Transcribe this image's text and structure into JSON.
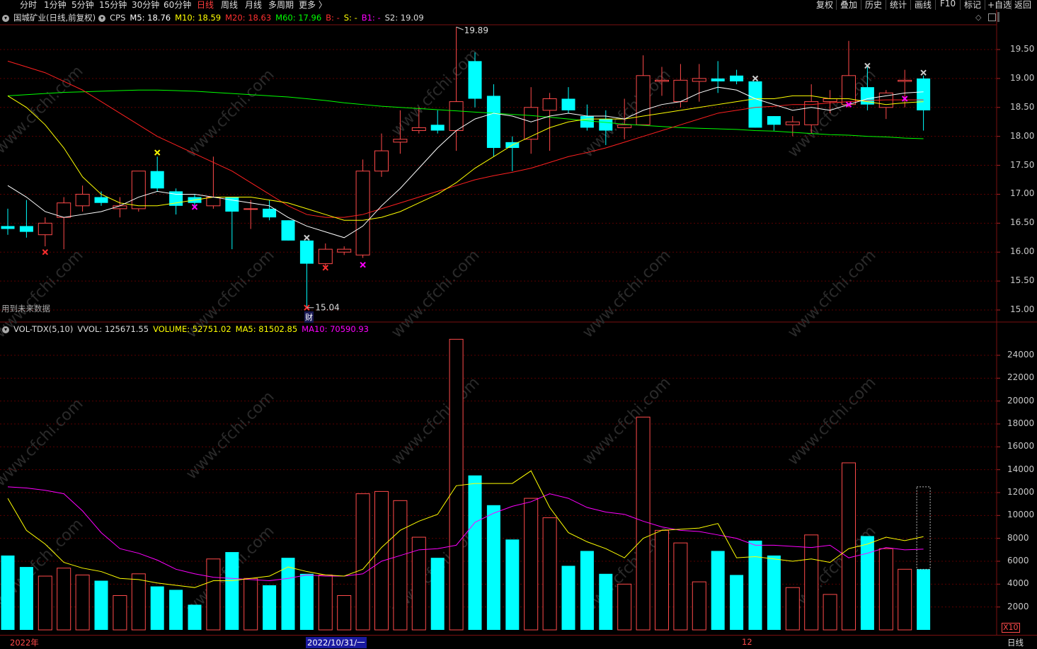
{
  "toolbar": {
    "periods": [
      "分时",
      "1分钟",
      "5分钟",
      "15分钟",
      "30分钟",
      "60分钟",
      "日线",
      "周线",
      "月线",
      "多周期",
      "更多 〉"
    ],
    "active_period": "日线",
    "right_buttons": [
      "复权",
      "叠加",
      "历史",
      "统计",
      "画线",
      "F10",
      "标记",
      "+自选",
      "返回"
    ]
  },
  "main_info": {
    "title": "国城矿业(日线,前复权)",
    "indicator": "CPS",
    "m5": "M5: 18.76",
    "m10": "M10: 18.59",
    "m20": "M20: 18.63",
    "m60": "M60: 17.96",
    "b": "B: -",
    "s": "S: -",
    "b1": "B1: -",
    "s2": "S2: 19.09"
  },
  "vol_info": {
    "name": "VOL-TDX(5,10)",
    "vvol": "VVOL: 125671.55",
    "volume": "VOLUME: 52751.02",
    "ma5": "MA5: 81502.85",
    "ma10": "MA10: 70590.93"
  },
  "price_axis": [
    "19.50",
    "19.00",
    "18.50",
    "18.00",
    "17.50",
    "17.00",
    "16.50",
    "16.00",
    "15.50",
    "15.00"
  ],
  "vol_axis": [
    "24000",
    "22000",
    "20000",
    "18000",
    "16000",
    "14000",
    "12000",
    "10000",
    "8000",
    "6000",
    "4000",
    "2000"
  ],
  "annotations": {
    "high": "19.89",
    "low": "15.04",
    "cai": "财",
    "future_data": "用到未来数据",
    "x10": "X10"
  },
  "bottom_bar": {
    "year": "2022年",
    "date": "2022/10/31/一",
    "month": "12",
    "period": "日线"
  },
  "watermark": "www.cfchi.com",
  "colors": {
    "up": "#ff4a4a",
    "down": "#00ffff",
    "m5": "#ffffff",
    "m10": "#ffff00",
    "m20": "#ff2020",
    "m60": "#00ff00",
    "ma10_vol": "#ff00ff",
    "grid": "#5a0000"
  },
  "chart_data": {
    "type": "candlestick",
    "price_ylim": [
      15.0,
      19.9
    ],
    "candles": [
      {
        "o": 16.45,
        "h": 16.75,
        "l": 16.3,
        "c": 16.4
      },
      {
        "o": 16.45,
        "h": 16.9,
        "l": 16.25,
        "c": 16.35
      },
      {
        "o": 16.3,
        "h": 16.6,
        "l": 16.1,
        "c": 16.5
      },
      {
        "o": 16.6,
        "h": 16.95,
        "l": 16.05,
        "c": 16.85
      },
      {
        "o": 16.8,
        "h": 17.15,
        "l": 16.7,
        "c": 17.0
      },
      {
        "o": 16.95,
        "h": 17.05,
        "l": 16.8,
        "c": 16.85
      },
      {
        "o": 16.75,
        "h": 16.95,
        "l": 16.6,
        "c": 16.8
      },
      {
        "o": 16.75,
        "h": 17.4,
        "l": 16.7,
        "c": 17.4
      },
      {
        "o": 17.4,
        "h": 17.65,
        "l": 17.05,
        "c": 17.1
      },
      {
        "o": 17.05,
        "h": 17.1,
        "l": 16.65,
        "c": 16.8
      },
      {
        "o": 16.95,
        "h": 17.0,
        "l": 16.8,
        "c": 16.85
      },
      {
        "o": 16.8,
        "h": 17.65,
        "l": 16.75,
        "c": 16.95
      },
      {
        "o": 16.95,
        "h": 16.95,
        "l": 16.05,
        "c": 16.7
      },
      {
        "o": 16.75,
        "h": 16.9,
        "l": 16.4,
        "c": 16.75
      },
      {
        "o": 16.75,
        "h": 16.9,
        "l": 16.55,
        "c": 16.6
      },
      {
        "o": 16.55,
        "h": 16.55,
        "l": 16.2,
        "c": 16.2
      },
      {
        "o": 16.2,
        "h": 16.2,
        "l": 15.04,
        "c": 15.8
      },
      {
        "o": 15.8,
        "h": 16.15,
        "l": 15.75,
        "c": 16.05
      },
      {
        "o": 16.0,
        "h": 16.1,
        "l": 15.95,
        "c": 16.05
      },
      {
        "o": 15.95,
        "h": 17.6,
        "l": 15.9,
        "c": 17.4
      },
      {
        "o": 17.4,
        "h": 18.05,
        "l": 17.3,
        "c": 17.75
      },
      {
        "o": 17.9,
        "h": 18.45,
        "l": 17.7,
        "c": 17.95
      },
      {
        "o": 18.1,
        "h": 18.5,
        "l": 18.05,
        "c": 18.15
      },
      {
        "o": 18.2,
        "h": 18.45,
        "l": 18.05,
        "c": 18.1
      },
      {
        "o": 18.1,
        "h": 19.89,
        "l": 17.75,
        "c": 18.6
      },
      {
        "o": 19.3,
        "h": 19.45,
        "l": 18.5,
        "c": 18.65
      },
      {
        "o": 18.7,
        "h": 18.9,
        "l": 17.65,
        "c": 17.8
      },
      {
        "o": 17.9,
        "h": 18.0,
        "l": 17.4,
        "c": 17.8
      },
      {
        "o": 17.95,
        "h": 18.85,
        "l": 17.7,
        "c": 18.5
      },
      {
        "o": 18.45,
        "h": 18.75,
        "l": 17.75,
        "c": 18.65
      },
      {
        "o": 18.65,
        "h": 18.85,
        "l": 18.4,
        "c": 18.45
      },
      {
        "o": 18.35,
        "h": 18.55,
        "l": 18.1,
        "c": 18.15
      },
      {
        "o": 18.3,
        "h": 18.45,
        "l": 17.85,
        "c": 18.1
      },
      {
        "o": 18.15,
        "h": 18.65,
        "l": 17.95,
        "c": 18.2
      },
      {
        "o": 18.2,
        "h": 19.4,
        "l": 18.2,
        "c": 19.05
      },
      {
        "o": 18.95,
        "h": 19.2,
        "l": 18.7,
        "c": 18.97
      },
      {
        "o": 18.6,
        "h": 19.25,
        "l": 18.5,
        "c": 18.97
      },
      {
        "o": 18.95,
        "h": 19.25,
        "l": 18.6,
        "c": 19.0
      },
      {
        "o": 19.0,
        "h": 19.3,
        "l": 18.75,
        "c": 18.95
      },
      {
        "o": 19.05,
        "h": 19.15,
        "l": 18.9,
        "c": 18.95
      },
      {
        "o": 18.95,
        "h": 18.95,
        "l": 18.15,
        "c": 18.15
      },
      {
        "o": 18.35,
        "h": 18.35,
        "l": 18.1,
        "c": 18.2
      },
      {
        "o": 18.2,
        "h": 18.35,
        "l": 18.0,
        "c": 18.25
      },
      {
        "o": 18.2,
        "h": 18.9,
        "l": 18.05,
        "c": 18.6
      },
      {
        "o": 18.6,
        "h": 18.8,
        "l": 18.4,
        "c": 18.65
      },
      {
        "o": 18.55,
        "h": 19.65,
        "l": 18.5,
        "c": 19.05
      },
      {
        "o": 18.85,
        "h": 19.2,
        "l": 18.45,
        "c": 18.55
      },
      {
        "o": 18.5,
        "h": 18.8,
        "l": 18.3,
        "c": 18.75
      },
      {
        "o": 18.95,
        "h": 19.15,
        "l": 18.5,
        "c": 18.97
      },
      {
        "o": 19.0,
        "h": 19.05,
        "l": 18.1,
        "c": 18.45
      }
    ],
    "m5": [
      17.15,
      16.95,
      16.7,
      16.6,
      16.65,
      16.7,
      16.8,
      16.95,
      17.05,
      17.0,
      17.0,
      16.95,
      16.9,
      16.85,
      16.8,
      16.6,
      16.45,
      16.35,
      16.25,
      16.45,
      16.8,
      17.1,
      17.45,
      17.8,
      18.1,
      18.3,
      18.4,
      18.35,
      18.25,
      18.35,
      18.4,
      18.35,
      18.35,
      18.3,
      18.45,
      18.55,
      18.6,
      18.75,
      18.85,
      18.8,
      18.65,
      18.55,
      18.45,
      18.5,
      18.45,
      18.55,
      18.65,
      18.7,
      18.75,
      18.77
    ],
    "m10": [
      18.7,
      18.5,
      18.2,
      17.8,
      17.3,
      17.0,
      16.85,
      16.8,
      16.8,
      16.85,
      16.9,
      16.95,
      16.95,
      16.95,
      16.9,
      16.85,
      16.75,
      16.65,
      16.55,
      16.55,
      16.6,
      16.7,
      16.85,
      17.0,
      17.2,
      17.45,
      17.65,
      17.85,
      18.0,
      18.15,
      18.25,
      18.3,
      18.3,
      18.3,
      18.35,
      18.4,
      18.45,
      18.5,
      18.55,
      18.6,
      18.65,
      18.65,
      18.7,
      18.7,
      18.65,
      18.65,
      18.6,
      18.55,
      18.58,
      18.6
    ],
    "m20": [
      19.3,
      19.2,
      19.1,
      18.95,
      18.8,
      18.6,
      18.4,
      18.2,
      18.0,
      17.85,
      17.7,
      17.55,
      17.4,
      17.2,
      17.0,
      16.8,
      16.65,
      16.6,
      16.6,
      16.65,
      16.75,
      16.85,
      16.95,
      17.05,
      17.15,
      17.25,
      17.32,
      17.38,
      17.45,
      17.55,
      17.65,
      17.72,
      17.8,
      17.9,
      18.0,
      18.1,
      18.2,
      18.3,
      18.4,
      18.45,
      18.5,
      18.52,
      18.55,
      18.55,
      18.58,
      18.6,
      18.62,
      18.63,
      18.63,
      18.63
    ],
    "m60": [
      18.7,
      18.72,
      18.74,
      18.76,
      18.77,
      18.78,
      18.79,
      18.8,
      18.8,
      18.79,
      18.78,
      18.76,
      18.74,
      18.72,
      18.7,
      18.68,
      18.65,
      18.62,
      18.58,
      18.55,
      18.52,
      18.5,
      18.48,
      18.46,
      18.44,
      18.42,
      18.4,
      18.38,
      18.36,
      18.33,
      18.3,
      18.27,
      18.24,
      18.21,
      18.19,
      18.17,
      18.15,
      18.14,
      18.13,
      18.12,
      18.1,
      18.09,
      18.07,
      18.05,
      18.03,
      18.02,
      18.0,
      17.99,
      17.97,
      17.96
    ],
    "vol_ylim": [
      0,
      25000
    ],
    "volumes": [
      6500,
      5500,
      4700,
      5400,
      4800,
      4300,
      3000,
      4900,
      3800,
      3500,
      2200,
      6200,
      6800,
      4500,
      3900,
      6300,
      4900,
      4800,
      3000,
      11900,
      12100,
      11300,
      8100,
      6300,
      25400,
      13500,
      10900,
      7900,
      11500,
      9800,
      5600,
      6900,
      4900,
      4000,
      18600,
      8700,
      7600,
      4200,
      6900,
      4800,
      7800,
      6500,
      3700,
      8300,
      3100,
      14600,
      8200,
      7100,
      5300,
      5300
    ],
    "vol_ma5": [
      11500,
      8700,
      7500,
      5900,
      5400,
      5100,
      4500,
      4400,
      4100,
      3900,
      3700,
      4300,
      4300,
      4500,
      4700,
      5500,
      5100,
      4800,
      4700,
      5300,
      7200,
      8700,
      9500,
      10100,
      12600,
      12800,
      12800,
      12800,
      13900,
      10700,
      8500,
      7700,
      7100,
      6300,
      8000,
      8700,
      8800,
      8900,
      9300,
      6300,
      6400,
      6200,
      6000,
      6200,
      5900,
      7100,
      7500,
      8100,
      7800,
      8150
    ],
    "vol_ma10": [
      12500,
      12400,
      12200,
      11900,
      10400,
      8500,
      7100,
      6700,
      6100,
      5300,
      4900,
      4600,
      4500,
      4400,
      4300,
      4500,
      4800,
      4700,
      4700,
      4900,
      6000,
      6500,
      7000,
      7100,
      7400,
      9400,
      10200,
      10800,
      11200,
      11900,
      11500,
      10700,
      10300,
      10100,
      9500,
      9000,
      8700,
      8600,
      8300,
      8000,
      7400,
      7400,
      7300,
      7200,
      7400,
      6300,
      6700,
      7200,
      7000,
      7060
    ]
  }
}
